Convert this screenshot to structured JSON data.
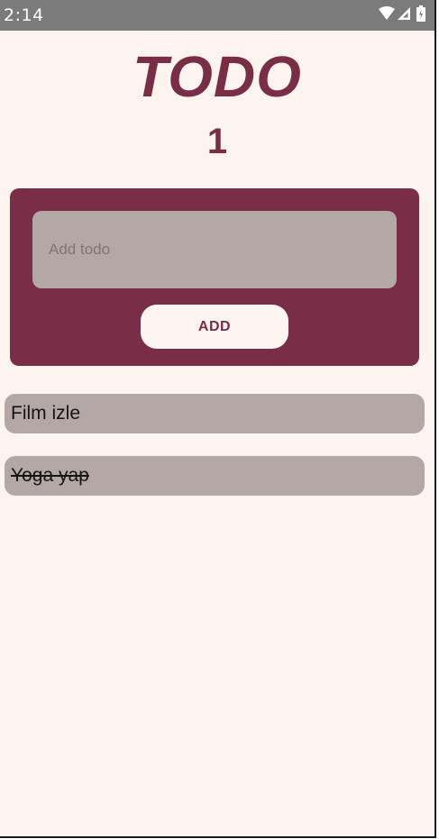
{
  "status_bar": {
    "time": "2:14",
    "icons": [
      "wifi-icon",
      "signal-icon",
      "battery-icon"
    ]
  },
  "header": {
    "title": "TODO",
    "count": "1"
  },
  "form": {
    "placeholder": "Add todo",
    "value": "",
    "add_label": "ADD"
  },
  "todos": [
    {
      "text": "Film izle",
      "done": false
    },
    {
      "text": "Yoga yap",
      "done": true
    }
  ],
  "colors": {
    "accent": "#7a2d46",
    "background": "#fcf4ef",
    "item_background": "#b3a8a6",
    "status_bar": "#7b7b7b"
  }
}
